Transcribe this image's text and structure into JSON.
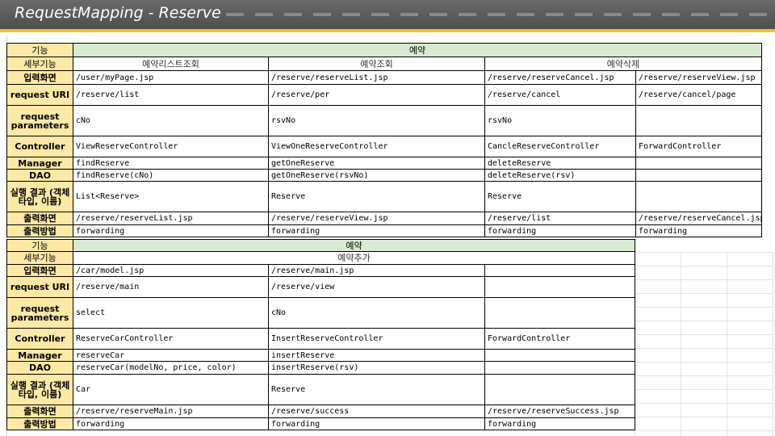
{
  "header": {
    "title": "RequestMapping - Reserve"
  },
  "colors": {
    "header_bg": "#5c5c5c",
    "accent": "#f2c21b",
    "label_bg": "#fde9a5",
    "group_bg": "#d8ead2"
  },
  "table1": {
    "group_label": "기능",
    "group": "예약",
    "sub_label": "세부기능",
    "subs": [
      "예약리스트조회",
      "예약조회",
      "예약삭제"
    ],
    "rows": [
      {
        "label": "입력화면",
        "cells": [
          "/user/myPage.jsp",
          "/reserve/reserveList.jsp",
          "/reserve/reserveCancel.jsp",
          "/reserve/reserveView.jsp"
        ]
      },
      {
        "label": "request URI",
        "cells": [
          "/reserve/list",
          "/reserve/per",
          "/reserve/cancel",
          "/reserve/cancel/page"
        ]
      },
      {
        "label": "request parameters",
        "cells": [
          "cNo",
          "rsvNo",
          "rsvNo",
          ""
        ]
      },
      {
        "label": "Controller",
        "cells": [
          "ViewReserveController",
          "ViewOneReserveController",
          "CancleReserveController",
          "ForwardController"
        ]
      },
      {
        "label": "Manager",
        "cells": [
          "findReserve",
          "getOneReserve",
          "deleteReserve",
          ""
        ]
      },
      {
        "label": "DAO",
        "cells": [
          "findReserve(cNo)",
          "getOneReserve(rsvNo)",
          "deleteReserve(rsv)",
          ""
        ]
      },
      {
        "label": "실행 결과 (객체타입, 이름)",
        "cells": [
          "List<Reserve>",
          "Reserve",
          "Reserve",
          ""
        ]
      },
      {
        "label": "출력화면",
        "cells": [
          "/reserve/reserveList.jsp",
          "/reserve/reserveView.jsp",
          "/reserve/list",
          "/reserve/reserveCancel.jsp"
        ]
      },
      {
        "label": "출력방법",
        "cells": [
          "forwarding",
          "forwarding",
          "forwarding",
          "forwarding"
        ]
      }
    ]
  },
  "table2": {
    "group_label": "기능",
    "group": "예약",
    "sub_label": "세부기능",
    "sub": "예약추가",
    "rows": [
      {
        "label": "입력화면",
        "cells": [
          "/car/model.jsp",
          "/reserve/main.jsp",
          ""
        ]
      },
      {
        "label": "request URI",
        "cells": [
          "/reserve/main",
          "/reserve/view",
          ""
        ]
      },
      {
        "label": "request parameters",
        "cells": [
          "select",
          "cNo",
          ""
        ]
      },
      {
        "label": "Controller",
        "cells": [
          "ReserveCarController",
          "InsertReserveController",
          "ForwardController"
        ]
      },
      {
        "label": "Manager",
        "cells": [
          "reserveCar",
          "insertReserve",
          ""
        ]
      },
      {
        "label": "DAO",
        "cells": [
          "reserveCar(modelNo, price, color)",
          "insertReserve(rsv)",
          ""
        ]
      },
      {
        "label": "실행 결과 (객체타입, 이름)",
        "cells": [
          "Car",
          "Reserve",
          ""
        ]
      },
      {
        "label": "출력화면",
        "cells": [
          "/reserve/reserveMain.jsp",
          "/reserve/success",
          "/reserve/reserveSuccess.jsp"
        ]
      },
      {
        "label": "출력방법",
        "cells": [
          "forwarding",
          "forwarding",
          "forwarding"
        ]
      }
    ]
  }
}
